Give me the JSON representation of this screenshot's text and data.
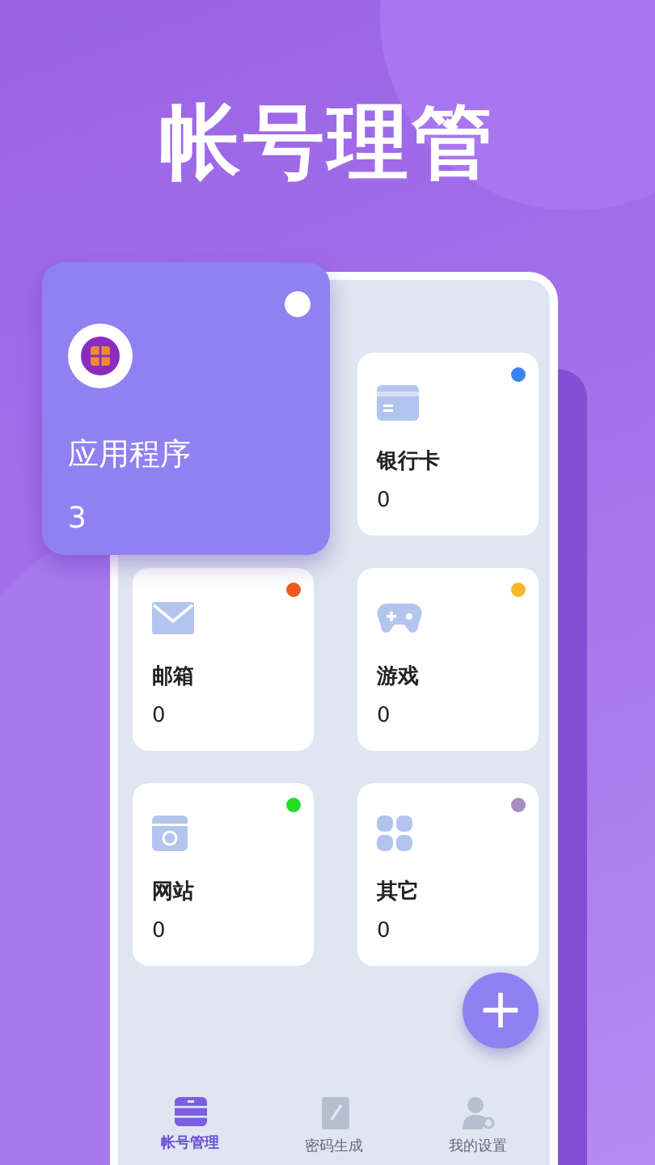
{
  "headline": "帐号理管",
  "categories": [
    {
      "kind": "featured",
      "name": "应用程序",
      "count": "3",
      "color": "#ffffff"
    },
    {
      "kind": "card",
      "name": "银行卡",
      "count": "0",
      "color": "#3b82f6"
    },
    {
      "kind": "card",
      "name": "邮箱",
      "count": "0",
      "color": "#f05a1e"
    },
    {
      "kind": "card",
      "name": "游戏",
      "count": "0",
      "color": "#f5b82a"
    },
    {
      "kind": "card",
      "name": "网站",
      "count": "0",
      "color": "#22dd22"
    },
    {
      "kind": "card",
      "name": "其它",
      "count": "0",
      "color": "#a98bc0"
    }
  ],
  "fab": {
    "label": "+"
  },
  "tabs": [
    {
      "label": "帐号管理",
      "selected": true
    },
    {
      "label": "密码生成",
      "selected": false
    },
    {
      "label": "我的设置",
      "selected": false
    }
  ]
}
